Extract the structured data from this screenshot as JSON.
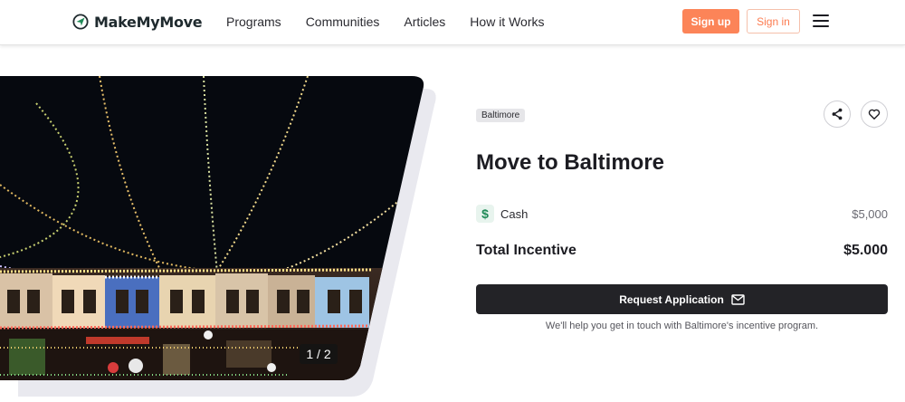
{
  "header": {
    "brand": "MakeMyMove",
    "nav": [
      "Programs",
      "Communities",
      "Articles",
      "How it Works"
    ],
    "signup_label": "Sign up",
    "signin_label": "Sign in"
  },
  "gallery": {
    "counter": "1 / 2"
  },
  "listing": {
    "tag": "Baltimore",
    "title": "Move to Baltimore",
    "cash_label": "Cash",
    "cash_value": "$5,000",
    "total_label": "Total Incentive",
    "total_value": "$5.000",
    "request_label": "Request Application",
    "help_text": "We'll help you get in touch with Baltimore's incentive program."
  },
  "colors": {
    "accent": "#fc8458",
    "dark_button": "#232327",
    "cash_icon": "#1f8a57"
  },
  "icons": [
    "logo-mark-icon",
    "menu-icon",
    "share-icon",
    "heart-icon",
    "dollar-icon",
    "mail-icon"
  ]
}
